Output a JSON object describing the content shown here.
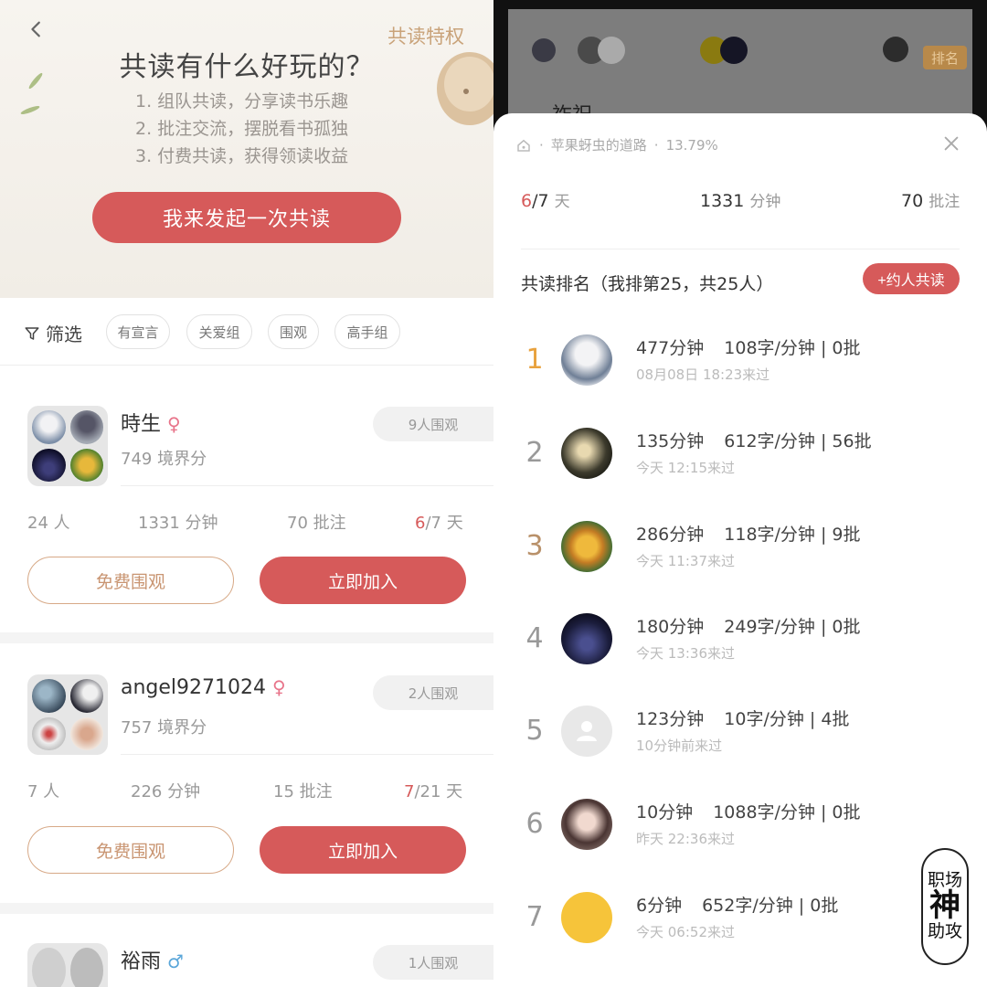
{
  "left": {
    "hero": {
      "privilege": "共读特权",
      "title": "共读有什么好玩的？",
      "items": [
        "1. 组队共读，分享读书乐趣",
        "2. 批注交流，摆脱看书孤独",
        "3. 付费共读，获得领读收益"
      ],
      "start_button": "我来发起一次共读"
    },
    "filter": {
      "label": "筛选",
      "chips": [
        "有宣言",
        "关爱组",
        "围观",
        "高手组"
      ]
    },
    "groups": [
      {
        "name": "時生",
        "gender": "♀",
        "score": "749 境界分",
        "watchers": "9人围观",
        "members": "24 人",
        "minutes": "1331 分钟",
        "notes": "70 批注",
        "days_done": "6",
        "days_total": "/7 天",
        "watch_button": "免费围观",
        "join_button": "立即加入"
      },
      {
        "name": "angel9271024",
        "gender": "♀",
        "score": "757 境界分",
        "watchers": "2人围观",
        "members": "7 人",
        "minutes": "226 分钟",
        "notes": "15 批注",
        "days_done": "7",
        "days_total": "/21 天",
        "watch_button": "免费围观",
        "join_button": "立即加入"
      },
      {
        "name": "裕雨",
        "gender": "♂",
        "watchers": "1人围观"
      }
    ]
  },
  "right": {
    "behind": {
      "rank_label": "排名",
      "partial_text": "祚祝"
    },
    "sheet": {
      "book": "苹果蚜虫的道路",
      "progress": "13.79%",
      "days_done": "6",
      "days_total": "/7",
      "days_unit": "天",
      "minutes": "1331",
      "minutes_unit": "分钟",
      "notes": "70",
      "notes_unit": "批注",
      "rank_title": "共读排名（我排第25，共25人）",
      "invite_button": "+约人共读",
      "ranks": [
        {
          "rank": "1",
          "time": "477分钟",
          "speed": "108字/分钟 | 0批",
          "last": "08月08日 18:23来过"
        },
        {
          "rank": "2",
          "time": "135分钟",
          "speed": "612字/分钟 | 56批",
          "last": "今天 12:15来过"
        },
        {
          "rank": "3",
          "time": "286分钟",
          "speed": "118字/分钟 | 9批",
          "last": "今天 11:37来过"
        },
        {
          "rank": "4",
          "time": "180分钟",
          "speed": "249字/分钟 | 0批",
          "last": "今天 13:36来过"
        },
        {
          "rank": "5",
          "time": "123分钟",
          "speed": "10字/分钟 | 4批",
          "last": "10分钟前来过"
        },
        {
          "rank": "6",
          "time": "10分钟",
          "speed": "1088字/分钟 | 0批",
          "last": "昨天 22:36来过"
        },
        {
          "rank": "7",
          "time": "6分钟",
          "speed": "652字/分钟 | 0批",
          "last": "今天 06:52来过"
        }
      ]
    },
    "watermark": {
      "line1": "职场",
      "line2": "神",
      "line3": "助攻"
    }
  },
  "colors": {
    "accent": "#d65a5a",
    "gold": "#c9a37a",
    "rank_gold": "#e8a23e",
    "rank_bronze": "#b9916a"
  }
}
